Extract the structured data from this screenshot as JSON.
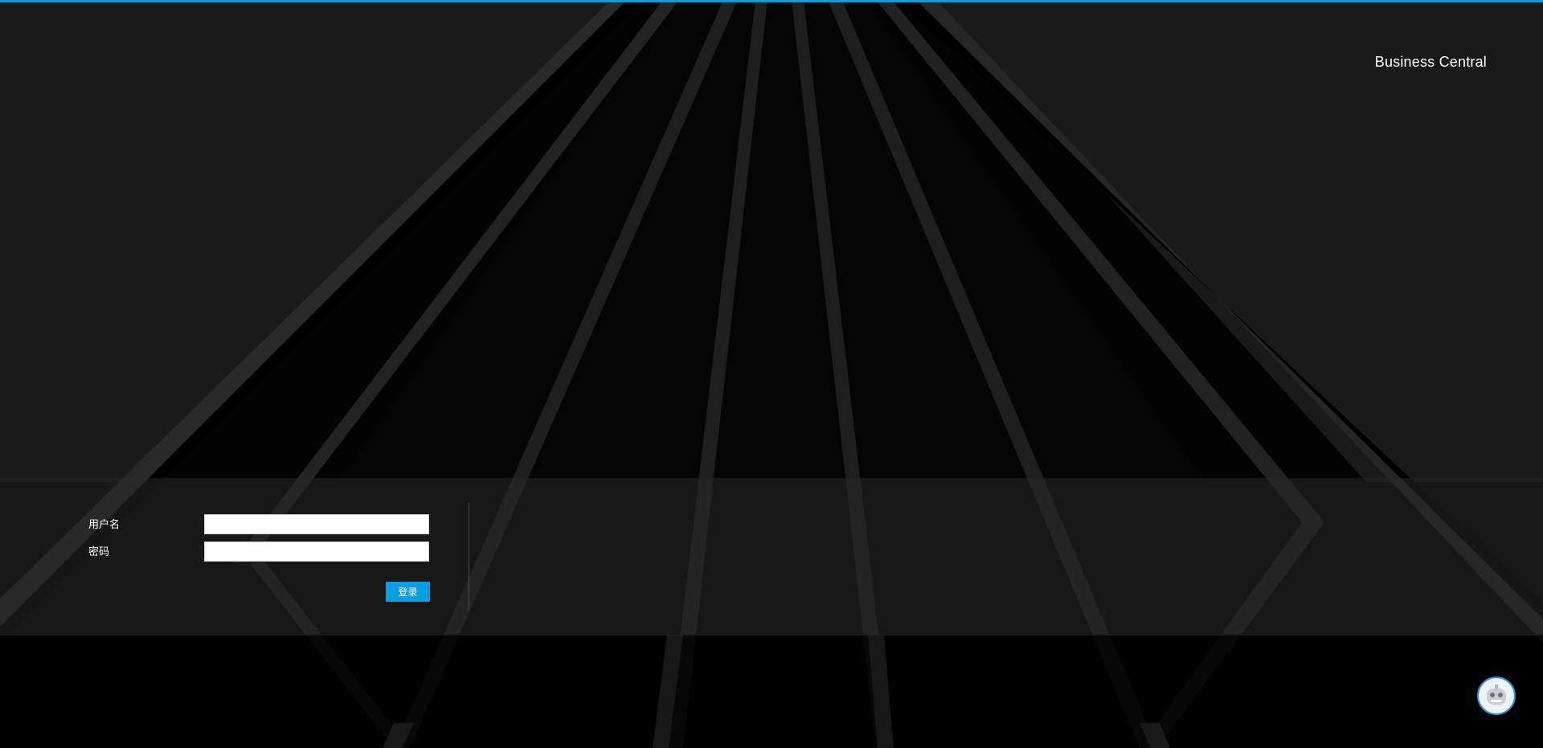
{
  "brand": {
    "title": "Business Central"
  },
  "login": {
    "username_label": "用户名",
    "username_value": "",
    "password_label": "密码",
    "password_value": "",
    "submit_label": "登录"
  },
  "assistant": {
    "icon": "robot-avatar-icon"
  },
  "colors": {
    "accent": "#0a9ee0",
    "background": "#050505",
    "band": "#1e1e1e"
  }
}
